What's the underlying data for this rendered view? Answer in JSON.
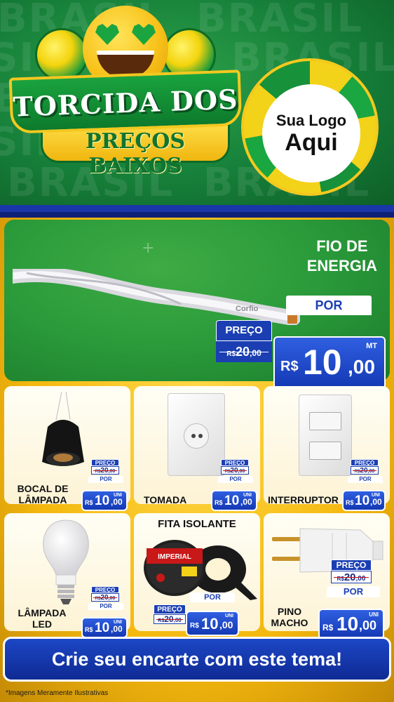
{
  "header": {
    "bg_word": "BRASIL",
    "headline_line1": "TORCIDA DOS",
    "headline_line2": "PREÇOS BAIXOS",
    "logo_line1": "Sua Logo",
    "logo_line2": "Aqui"
  },
  "hero": {
    "product": "FIO DE ENERGIA",
    "product_line1": "FIO DE",
    "product_line2": "ENERGIA",
    "brand_on_cable": "Corfio",
    "old_label": "PREÇO",
    "old_price": "R$20,00",
    "old_currency": "R$",
    "old_int": "20",
    "old_cents": ",00",
    "por_label": "POR",
    "currency": "R$",
    "price_int": "10",
    "price_cents": ",00",
    "unit": "MT"
  },
  "products": [
    {
      "name_line1": "BOCAL DE",
      "name_line2": "LÂMPADA",
      "old_label": "PREÇO",
      "old_currency": "R$",
      "old_int": "20",
      "old_cents": ",00",
      "por_label": "POR",
      "currency": "R$",
      "price_int": "10",
      "price_cents": ",00",
      "unit": "UNI",
      "icon": "bulb-socket-icon"
    },
    {
      "name_line1": "TOMADA",
      "name_line2": "",
      "old_label": "PREÇO",
      "old_currency": "R$",
      "old_int": "20",
      "old_cents": ",00",
      "por_label": "POR",
      "currency": "R$",
      "price_int": "10",
      "price_cents": ",00",
      "unit": "UNI",
      "icon": "outlet-icon"
    },
    {
      "name_line1": "INTERRUPTOR",
      "name_line2": "",
      "old_label": "PREÇO",
      "old_currency": "R$",
      "old_int": "20",
      "old_cents": ",00",
      "por_label": "POR",
      "currency": "R$",
      "price_int": "10",
      "price_cents": ",00",
      "unit": "UNI",
      "icon": "switch-icon"
    },
    {
      "name_line1": "LÂMPADA",
      "name_line2": "LED",
      "old_label": "PREÇO",
      "old_currency": "R$",
      "old_int": "20",
      "old_cents": ",00",
      "por_label": "POR",
      "currency": "R$",
      "price_int": "10",
      "price_cents": ",00",
      "unit": "UNI",
      "icon": "led-bulb-icon"
    },
    {
      "name_line1": "FITA ISOLANTE",
      "name_line2": "",
      "tape_brand": "IMPERIAL",
      "old_label": "PREÇO",
      "old_currency": "R$",
      "old_int": "20",
      "old_cents": ",00",
      "por_label": "POR",
      "currency": "R$",
      "price_int": "10",
      "price_cents": ",00",
      "unit": "UNI",
      "icon": "tape-icon"
    },
    {
      "name_line1": "PINO",
      "name_line2": "MACHO",
      "old_label": "PREÇO",
      "old_currency": "R$",
      "old_int": "20",
      "old_cents": ",00",
      "por_label": "POR",
      "currency": "R$",
      "price_int": "10",
      "price_cents": ",00",
      "unit": "UNI",
      "icon": "plug-icon"
    }
  ],
  "footer": {
    "cta": "Crie seu encarte com este tema!",
    "note": "*Imagens Meramente Ilustrativas"
  },
  "colors": {
    "green": "#1c7c2c",
    "yellow": "#f4b80e",
    "blue": "#1438b4",
    "white": "#ffffff"
  }
}
